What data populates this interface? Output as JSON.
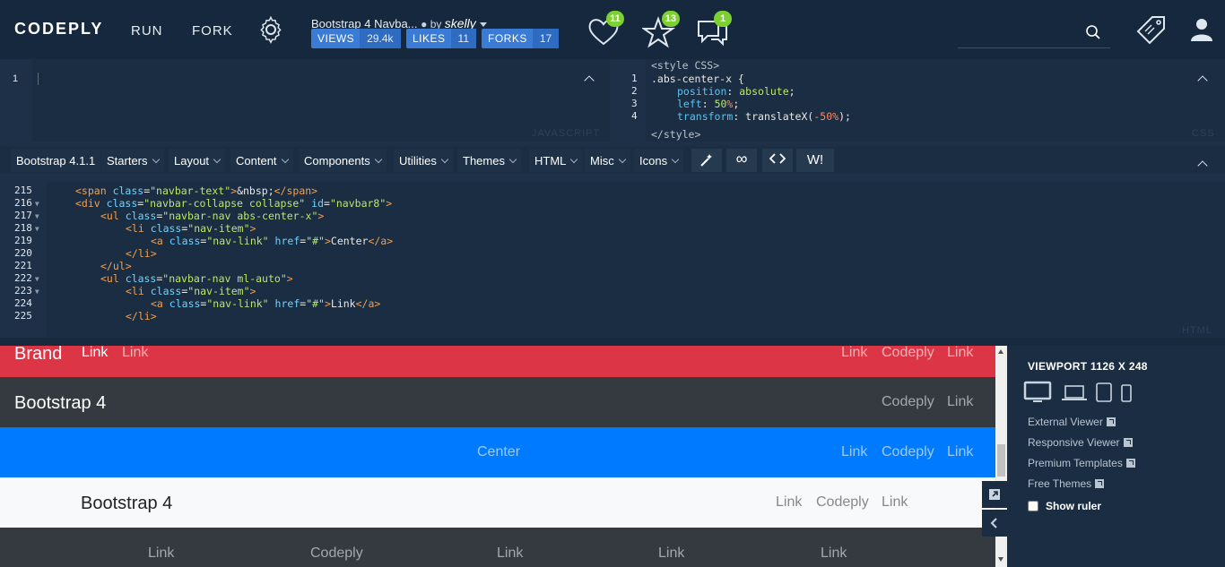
{
  "nav": {
    "logo": "CODEPLY",
    "run": "RUN",
    "fork": "FORK",
    "title": "Bootstrap 4 Navba...",
    "by": "by",
    "author": "skelly",
    "stats": [
      {
        "label": "VIEWS",
        "value": "29.4k"
      },
      {
        "label": "LIKES",
        "value": "11"
      },
      {
        "label": "FORKS",
        "value": "17"
      }
    ],
    "badges": {
      "likes": "11",
      "stars": "13",
      "comments": "1"
    },
    "search": {
      "placeholder": ""
    }
  },
  "editors": {
    "js_label": "JAVASCRIPT",
    "css_label": "CSS",
    "html_label": "HTML",
    "js_lines": [
      "1"
    ],
    "css_lines": [
      "1",
      "2",
      "3",
      "4"
    ],
    "css_code": {
      "open": "<style CSS>",
      "l1": ".abs-center-x {",
      "l2_prop": "position",
      "l2_val": "absolute",
      "l3_prop": "left",
      "l3_val": "50",
      "l4_prop": "transform",
      "l4_val": "translateX(",
      "l4_num": "-50",
      "close": "</style>"
    },
    "html_lines": [
      "215",
      "216",
      "217",
      "218",
      "219",
      "220",
      "221",
      "222",
      "223",
      "224",
      "225"
    ]
  },
  "toolbar": {
    "items": [
      "Bootstrap 4.1.1",
      "Starters",
      "Layout",
      "Content",
      "Components",
      "Utilities",
      "Themes",
      "HTML",
      "Misc",
      "Icons"
    ],
    "wi": "W!"
  },
  "preview": {
    "nav1": {
      "brand": "Brand",
      "link_a": "Link",
      "link_b": "Link",
      "right": [
        "Link",
        "Codeply",
        "Link"
      ],
      "color": "#dc3545"
    },
    "nav2": {
      "brand": "Bootstrap 4",
      "right": [
        "Codeply",
        "Link"
      ],
      "color": "#343a40"
    },
    "nav3": {
      "center": "Center",
      "right": [
        "Link",
        "Codeply",
        "Link"
      ],
      "color": "#007bff"
    },
    "nav4": {
      "brand": "Bootstrap 4",
      "right": [
        "Link",
        "Codeply",
        "Link"
      ],
      "color": "#f8f9fa"
    },
    "nav5": {
      "links": [
        "Link",
        "Codeply",
        "Link",
        "Link",
        "Link"
      ],
      "color": "#343a40"
    }
  },
  "side": {
    "viewport": "VIEWPORT 1126 X 248",
    "links": [
      "External Viewer",
      "Responsive Viewer",
      "Premium Templates",
      "Free Themes"
    ],
    "ruler": "Show ruler"
  }
}
